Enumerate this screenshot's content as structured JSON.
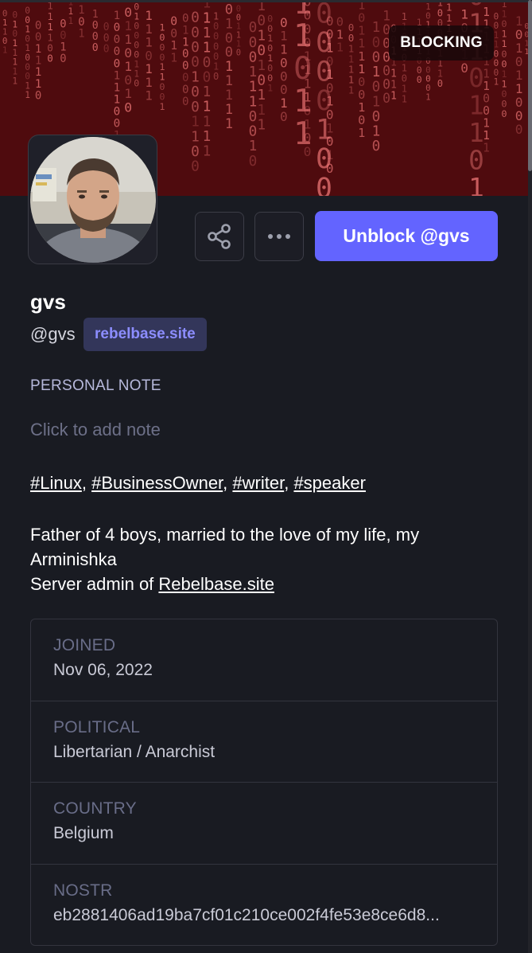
{
  "header": {
    "status_badge": "BLOCKING",
    "banner_digits": "1 0 0 1 0 1 1 0 1 0 0 1 1 0 1 0 1 1 0 0 1 0 1 1 0 1 0 0 1 1"
  },
  "actions": {
    "share_icon": "share-icon",
    "more_icon": "ellipsis-icon",
    "unblock_label": "Unblock @gvs"
  },
  "profile": {
    "display_name": "gvs",
    "handle": "@gvs",
    "domain": "rebelbase.site"
  },
  "personal_note": {
    "label": "PERSONAL NOTE",
    "placeholder": "Click to add note"
  },
  "bio": {
    "tags": [
      "#Linux",
      "#BusinessOwner",
      "#writer",
      "#speaker"
    ],
    "line1": "Father of 4 boys, married to the love of my life, my Arminishka",
    "line2_prefix": "Server admin of ",
    "line2_link": "Rebelbase.site"
  },
  "fields": [
    {
      "label": "JOINED",
      "value": "Nov 06, 2022"
    },
    {
      "label": "POLITICAL",
      "value": "Libertarian / Anarchist"
    },
    {
      "label": "COUNTRY",
      "value": "Belgium"
    },
    {
      "label": "NOSTR",
      "value": "eb2881406ad19ba7cf01c210ce002f4fe53e8ce6d8..."
    }
  ],
  "colors": {
    "background": "#191b22",
    "accent": "#6364ff",
    "domain_badge_bg": "#33365a",
    "domain_badge_text": "#8c8dff",
    "banner": "#5a0d10"
  }
}
